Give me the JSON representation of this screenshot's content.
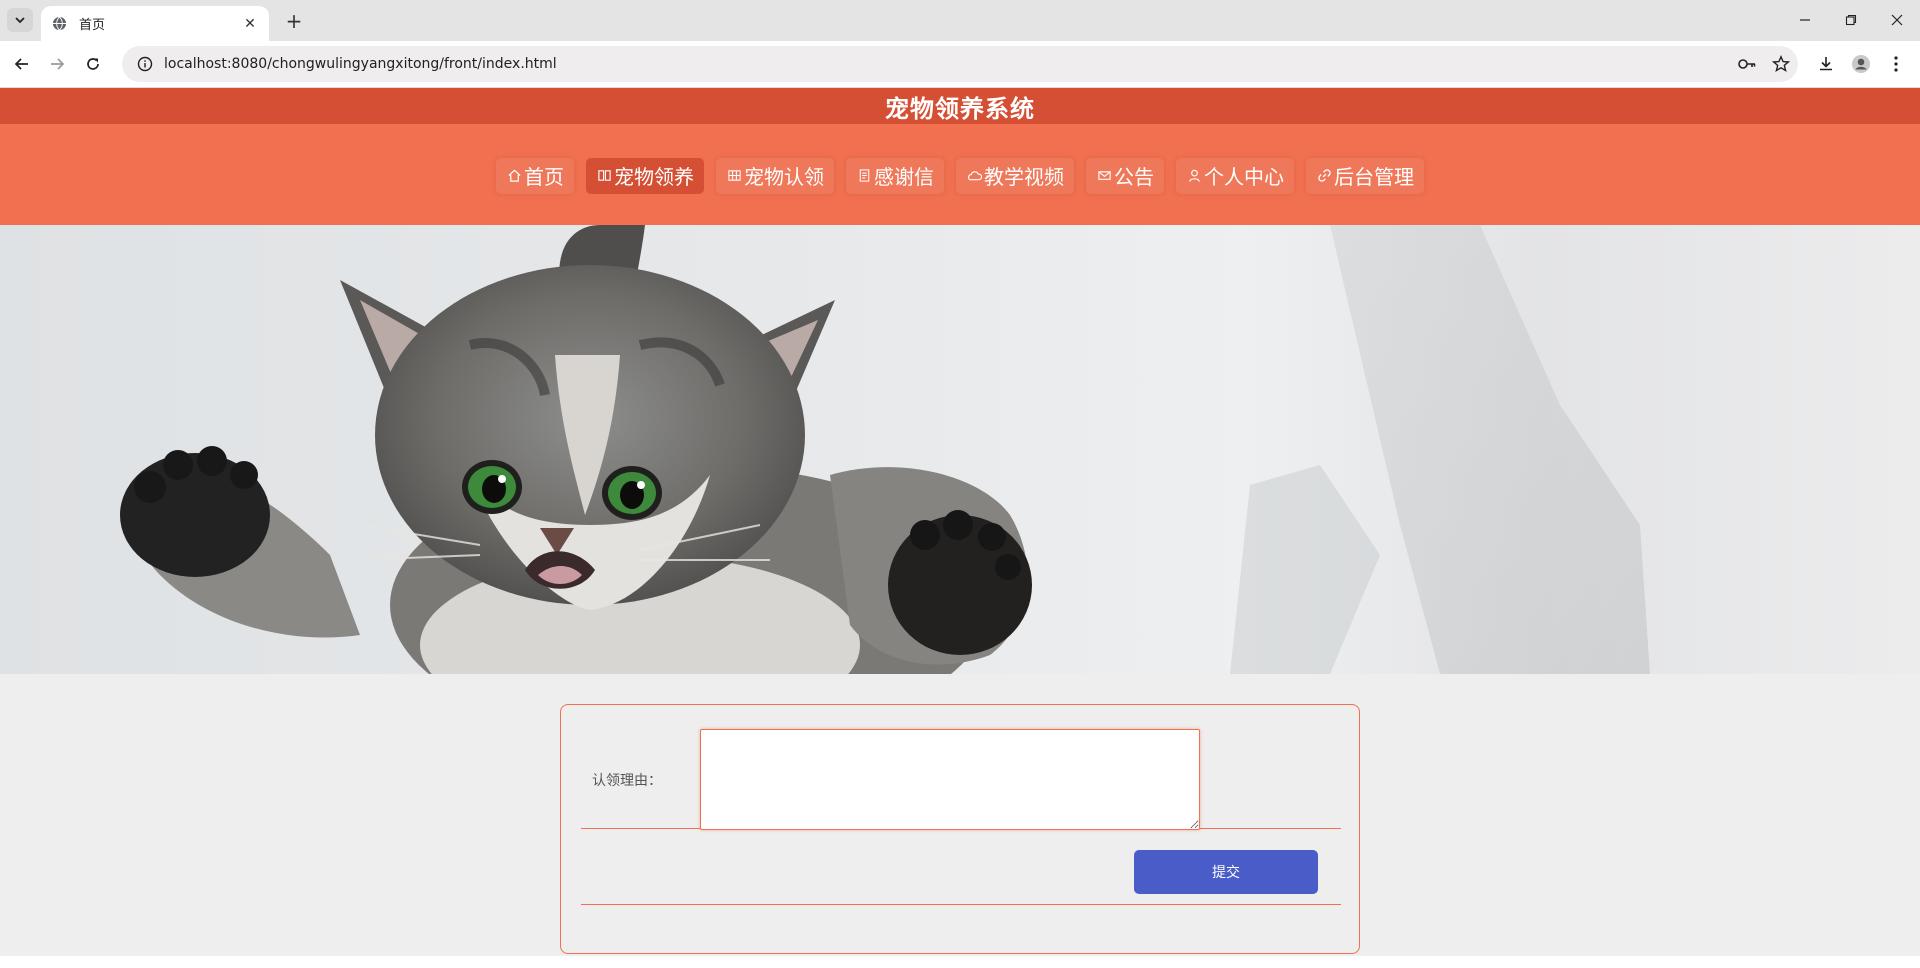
{
  "browser": {
    "tab_title": "首页",
    "url": "localhost:8080/chongwulingyangxitong/front/index.html"
  },
  "site": {
    "title": "宠物领养系统"
  },
  "nav": {
    "items": [
      {
        "label": "首页",
        "icon": "home-icon"
      },
      {
        "label": "宠物领养",
        "icon": "book-icon",
        "active": true
      },
      {
        "label": "宠物认领",
        "icon": "grid-icon"
      },
      {
        "label": "感谢信",
        "icon": "document-icon"
      },
      {
        "label": "教学视频",
        "icon": "cloud-icon"
      },
      {
        "label": "公告",
        "icon": "mail-icon"
      },
      {
        "label": "个人中心",
        "icon": "user-icon"
      },
      {
        "label": "后台管理",
        "icon": "link-icon"
      }
    ]
  },
  "carousel": {
    "slide_count": 3,
    "active_index": 0
  },
  "form": {
    "reason_label": "认领理由：",
    "reason_value": "",
    "submit_label": "提交"
  },
  "colors": {
    "header": "#d44f33",
    "nav": "#f07050",
    "accent": "#f07050",
    "submit": "#4a5cc8"
  }
}
